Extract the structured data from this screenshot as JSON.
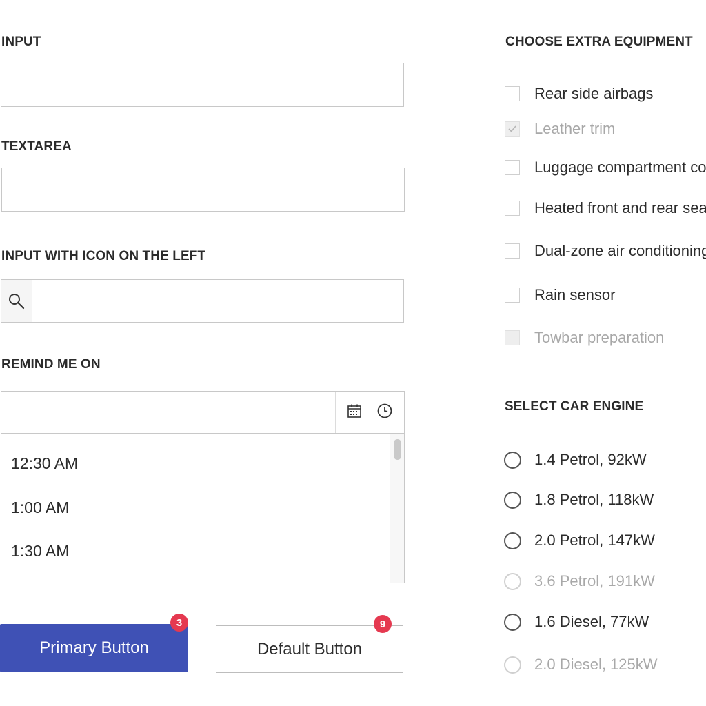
{
  "left": {
    "input_label": "INPUT",
    "input_value": "",
    "textarea_label": "TEXTAREA",
    "textarea_value": "",
    "icon_input_label": "INPUT WITH ICON ON THE LEFT",
    "icon_input_value": "",
    "icon_input_icon": "search-icon",
    "remind_label": "REMIND ME ON",
    "remind_value": "",
    "remind_icons": [
      "calendar-icon",
      "clock-icon"
    ],
    "times": [
      "12:30 AM",
      "1:00 AM",
      "1:30 AM"
    ]
  },
  "buttons": {
    "primary_label": "Primary Button",
    "primary_badge": "3",
    "default_label": "Default Button",
    "default_badge": "9"
  },
  "equipment": {
    "title": "CHOOSE EXTRA EQUIPMENT",
    "items": [
      {
        "label": "Rear side airbags",
        "checked": false,
        "disabled": false
      },
      {
        "label": "Leather trim",
        "checked": true,
        "disabled": true
      },
      {
        "label": "Luggage compartment cove",
        "checked": false,
        "disabled": false
      },
      {
        "label": "Heated front and rear seats",
        "checked": false,
        "disabled": false
      },
      {
        "label": "Dual-zone air conditioning",
        "checked": false,
        "disabled": false
      },
      {
        "label": "Rain sensor",
        "checked": false,
        "disabled": false
      },
      {
        "label": "Towbar preparation",
        "checked": false,
        "disabled": true
      }
    ]
  },
  "engine": {
    "title": "SELECT CAR ENGINE",
    "options": [
      {
        "label": "1.4 Petrol, 92kW",
        "disabled": false
      },
      {
        "label": "1.8 Petrol, 118kW",
        "disabled": false
      },
      {
        "label": "2.0 Petrol, 147kW",
        "disabled": false
      },
      {
        "label": "3.6 Petrol, 191kW",
        "disabled": true
      },
      {
        "label": "1.6 Diesel, 77kW",
        "disabled": false
      },
      {
        "label": "2.0 Diesel, 125kW",
        "disabled": true
      }
    ]
  },
  "colors": {
    "primary": "#3f51b5",
    "badge": "#e53950",
    "border": "#c8c8c8",
    "disabled_text": "#a8a8a8"
  }
}
